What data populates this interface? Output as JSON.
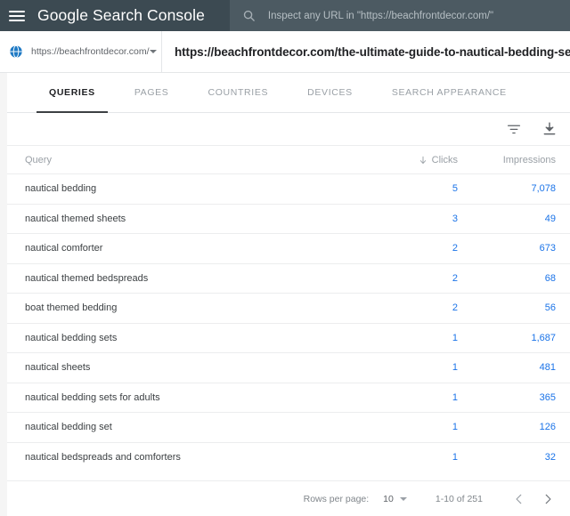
{
  "appbar": {
    "menu_icon": "hamburger-icon",
    "brand_google": "Google",
    "brand_product": "Search Console",
    "search_icon": "search-icon",
    "search_placeholder": "Inspect any URL in \"https://beachfrontdecor.com/\"",
    "background": "#3c4a52"
  },
  "urlbar": {
    "property_icon": "globe-icon",
    "property_label": "https://beachfrontdecor.com/",
    "property_caret_icon": "chevron-down-icon",
    "page_url": "https://beachfrontdecor.com/the-ultimate-guide-to-nautical-bedding-sets/"
  },
  "tabs": [
    {
      "label": "QUERIES",
      "active": true
    },
    {
      "label": "PAGES",
      "active": false
    },
    {
      "label": "COUNTRIES",
      "active": false
    },
    {
      "label": "DEVICES",
      "active": false
    },
    {
      "label": "SEARCH APPEARANCE",
      "active": false
    }
  ],
  "toolbar": {
    "filter_icon": "filter-icon",
    "download_icon": "download-icon"
  },
  "table": {
    "columns": {
      "query": "Query",
      "clicks": "Clicks",
      "impressions": "Impressions"
    },
    "sort": {
      "column": "clicks",
      "direction": "desc",
      "icon": "arrow-down-icon"
    },
    "rows": [
      {
        "query": "nautical bedding",
        "clicks": "5",
        "impressions": "7,078"
      },
      {
        "query": "nautical themed sheets",
        "clicks": "3",
        "impressions": "49"
      },
      {
        "query": "nautical comforter",
        "clicks": "2",
        "impressions": "673"
      },
      {
        "query": "nautical themed bedspreads",
        "clicks": "2",
        "impressions": "68"
      },
      {
        "query": "boat themed bedding",
        "clicks": "2",
        "impressions": "56"
      },
      {
        "query": "nautical bedding sets",
        "clicks": "1",
        "impressions": "1,687"
      },
      {
        "query": "nautical sheets",
        "clicks": "1",
        "impressions": "481"
      },
      {
        "query": "nautical bedding sets for adults",
        "clicks": "1",
        "impressions": "365"
      },
      {
        "query": "nautical bedding set",
        "clicks": "1",
        "impressions": "126"
      },
      {
        "query": "nautical bedspreads and comforters",
        "clicks": "1",
        "impressions": "32"
      }
    ]
  },
  "footer": {
    "rows_per_page_label": "Rows per page:",
    "rows_per_page_value": "10",
    "rows_per_page_caret_icon": "chevron-down-icon",
    "range": "1-10 of 251",
    "prev_icon": "chevron-left-icon",
    "next_icon": "chevron-right-icon"
  },
  "colors": {
    "appbar_bg": "#3c4a52",
    "link_blue": "#1a73e8",
    "text_primary": "#202124",
    "text_muted": "#9aa0a6"
  }
}
